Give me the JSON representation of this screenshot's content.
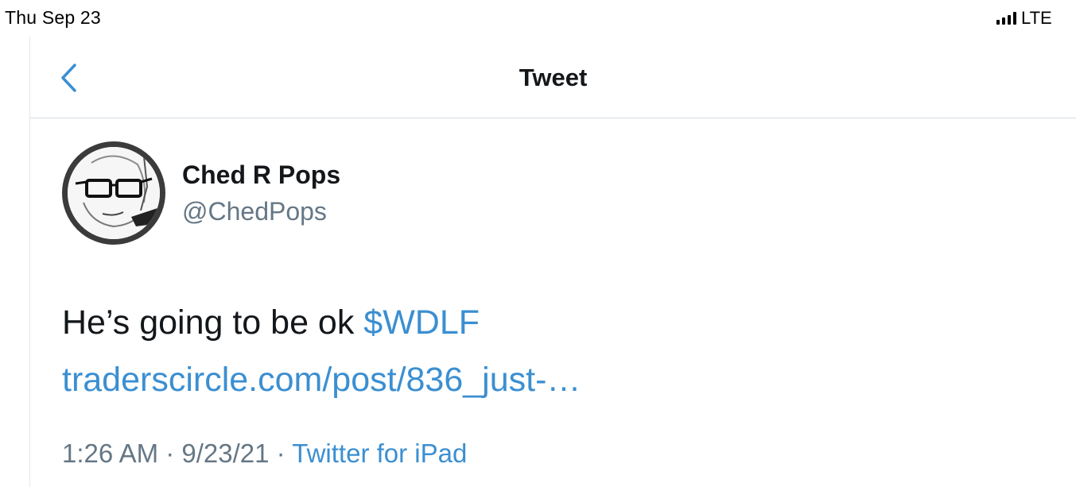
{
  "status_bar": {
    "date": "Thu Sep 23",
    "network": "LTE",
    "signal_bars": 4
  },
  "nav": {
    "back_icon": "chevron-left-icon",
    "title": "Tweet"
  },
  "tweet": {
    "author": {
      "name": "Ched R Pops",
      "handle": "@ChedPops",
      "avatar_icon": "sketched-face-with-glasses"
    },
    "text": "He’s going to be ok ",
    "cashtag": "$WDLF",
    "link": "traderscircle.com/post/836_just-…",
    "time": "1:26 AM",
    "separator": " · ",
    "date": "9/23/21",
    "source": "Twitter for iPad"
  },
  "colors": {
    "link": "#3b8fd1",
    "secondary_text": "#657786",
    "primary_text": "#14171a",
    "divider": "#d7dde2"
  }
}
